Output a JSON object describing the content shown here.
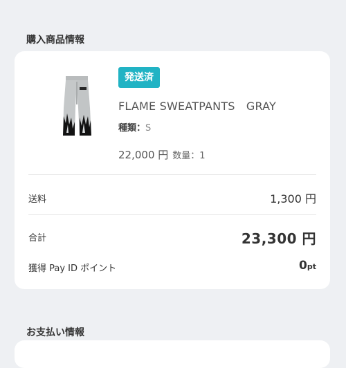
{
  "sections": {
    "purchase_info_title": "購入商品情報",
    "payment_info_title": "お支払い情報"
  },
  "item": {
    "status_badge": "発送済",
    "name": "FLAME SWEATPANTS　GRAY",
    "variant_label": "種類：",
    "variant_value": "S",
    "price": "22,000 円",
    "quantity": "数量：1",
    "thumbnail_icon": "gray-flame-sweatpants-image"
  },
  "summary": {
    "shipping_label": "送料",
    "shipping_value": "1,300 円",
    "total_label": "合計",
    "total_value": "23,300 円",
    "points_label": "獲得 Pay ID ポイント",
    "points_value": "0",
    "points_unit": "pt"
  },
  "colors": {
    "badge": "#21b3c4",
    "background": "#eef0f3",
    "card": "#ffffff"
  }
}
